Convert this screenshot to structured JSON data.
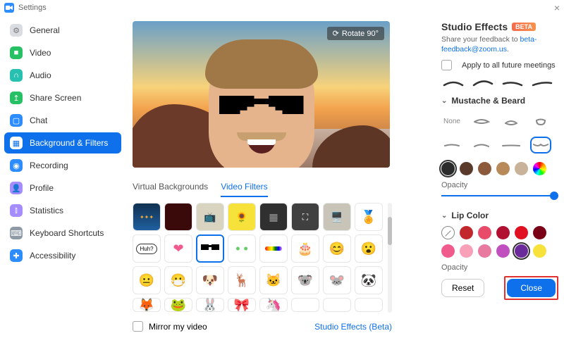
{
  "window": {
    "title": "Settings",
    "close_glyph": "×"
  },
  "sidebar": {
    "items": [
      {
        "label": "General",
        "icon_bg": "#d9dce0",
        "glyph": "⚙",
        "glyph_color": "#777"
      },
      {
        "label": "Video",
        "icon_bg": "#28c065",
        "glyph": "■"
      },
      {
        "label": "Audio",
        "icon_bg": "#28c0b0",
        "glyph": "∩"
      },
      {
        "label": "Share Screen",
        "icon_bg": "#28c065",
        "glyph": "↥"
      },
      {
        "label": "Chat",
        "icon_bg": "#2d8cff",
        "glyph": "▢"
      },
      {
        "label": "Background & Filters",
        "icon_bg": "#2d8cff",
        "glyph": "▦",
        "active": true
      },
      {
        "label": "Recording",
        "icon_bg": "#2d8cff",
        "glyph": "◉"
      },
      {
        "label": "Profile",
        "icon_bg": "#a58cff",
        "glyph": "👤"
      },
      {
        "label": "Statistics",
        "icon_bg": "#a58cff",
        "glyph": "⫾"
      },
      {
        "label": "Keyboard Shortcuts",
        "icon_bg": "#8e9aa6",
        "glyph": "⌨"
      },
      {
        "label": "Accessibility",
        "icon_bg": "#2d8cff",
        "glyph": "✚"
      }
    ]
  },
  "preview": {
    "rotate_label": "Rotate 90°"
  },
  "tabs": {
    "bg": "Virtual Backgrounds",
    "filters": "Video Filters"
  },
  "filters_grid": {
    "row1": [
      "dark",
      "dark",
      "dark",
      "dark",
      "dark",
      "dark",
      "dark",
      "dark"
    ],
    "huh": "Huh?"
  },
  "footer": {
    "mirror": "Mirror my video",
    "studio_link": "Studio Effects (Beta)"
  },
  "panel": {
    "title": "Studio Effects",
    "beta": "BETA",
    "feedback_prefix": "Share your feedback to  ",
    "feedback_link": "beta-feedback@zoom.us",
    "feedback_suffix": ".",
    "apply_all": "Apply to all future meetings",
    "mustache_head": "Mustache & Beard",
    "none_label": "None",
    "mustache_colors": [
      "#2b2b2b",
      "#5a3a2a",
      "#8a5a3a",
      "#b88a5a",
      "#c9b29a"
    ],
    "opacity_label": "Opacity",
    "lip_head": "Lip Color",
    "lip_colors_row1": [
      "#c1272d",
      "#e94b6a",
      "#b21030",
      "#e01020",
      "#7a0018"
    ],
    "lip_colors_row2": [
      "#f05a8c",
      "#f7a0b8",
      "#e87aa0",
      "#c050c0",
      "#6a2a9a",
      "#f7e23c"
    ],
    "lip_selected_index": 10,
    "reset": "Reset",
    "close": "Close"
  }
}
